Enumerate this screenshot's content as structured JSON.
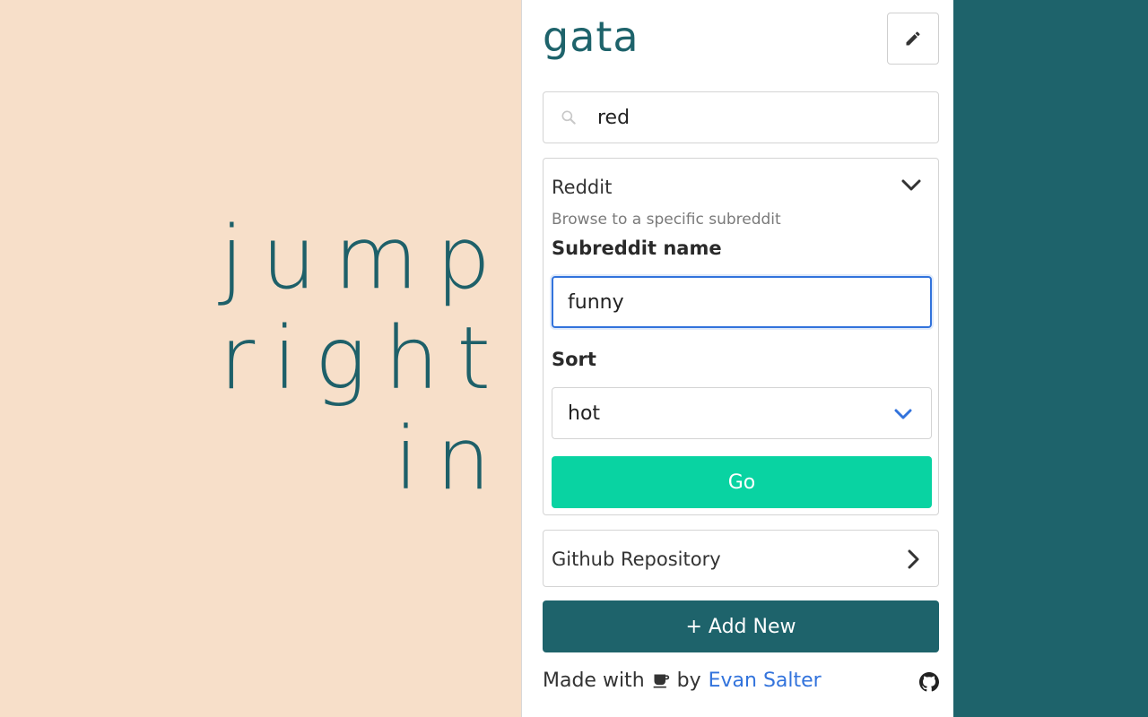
{
  "hero": {
    "lines": [
      "jump",
      "right",
      "in"
    ]
  },
  "header": {
    "logo": "gata",
    "edit_icon": "pencil-icon"
  },
  "search": {
    "value": "red",
    "placeholder": "",
    "icon": "search-icon"
  },
  "reddit_card": {
    "title": "Reddit",
    "description": "Browse to a specific subreddit",
    "subreddit_label": "Subreddit name",
    "subreddit_value": "funny",
    "sort_label": "Sort",
    "sort_value": "hot",
    "go_label": "Go"
  },
  "github_card": {
    "title": "Github Repository"
  },
  "add_new_label": "+ Add New",
  "footer": {
    "made_with": "Made with",
    "by": "by",
    "author": "Evan Salter",
    "cup_icon": "coffee-icon",
    "github_icon": "github-icon"
  },
  "colors": {
    "brand": "#1e636b",
    "accent": "#09d3a2",
    "link": "#3273dc",
    "page_bg": "#f7dfc9"
  }
}
